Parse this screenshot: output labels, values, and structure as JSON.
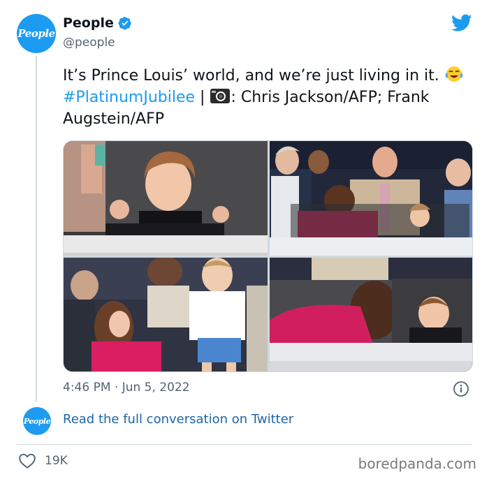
{
  "account": {
    "avatar_logo_text": "People",
    "display_name": "People",
    "handle": "@people",
    "verified": true
  },
  "tweet": {
    "text_part1": "It’s Prince Louis’ world, and we’re just living in it. ",
    "emoji_name": "face-with-tears-of-joy",
    "hashtag": "#PlatinumJubilee",
    "text_part2": " | ",
    "camera_icon": "camera-icon",
    "text_part3": ": Chris Jackson/AFP; Frank Augstein/AFP"
  },
  "media": {
    "photos": [
      {
        "name": "photo-louis-fists",
        "description_icon": "photo"
      },
      {
        "name": "photo-royal-box-crowd",
        "description_icon": "photo"
      },
      {
        "name": "photo-louis-standing",
        "description_icon": "photo"
      },
      {
        "name": "photo-louis-covering-face",
        "description_icon": "photo"
      }
    ]
  },
  "meta": {
    "timestamp": "4:46 PM · Jun 5, 2022"
  },
  "conversation": {
    "avatar_logo_text": "People",
    "link_text": "Read the full conversation on Twitter"
  },
  "engagement": {
    "likes": "19K"
  },
  "watermark": "boredpanda.com",
  "colors": {
    "brand_blue": "#1d9bf0",
    "link_blue": "#1d65a6",
    "secondary_text": "#536471",
    "border": "#cfd9de"
  }
}
